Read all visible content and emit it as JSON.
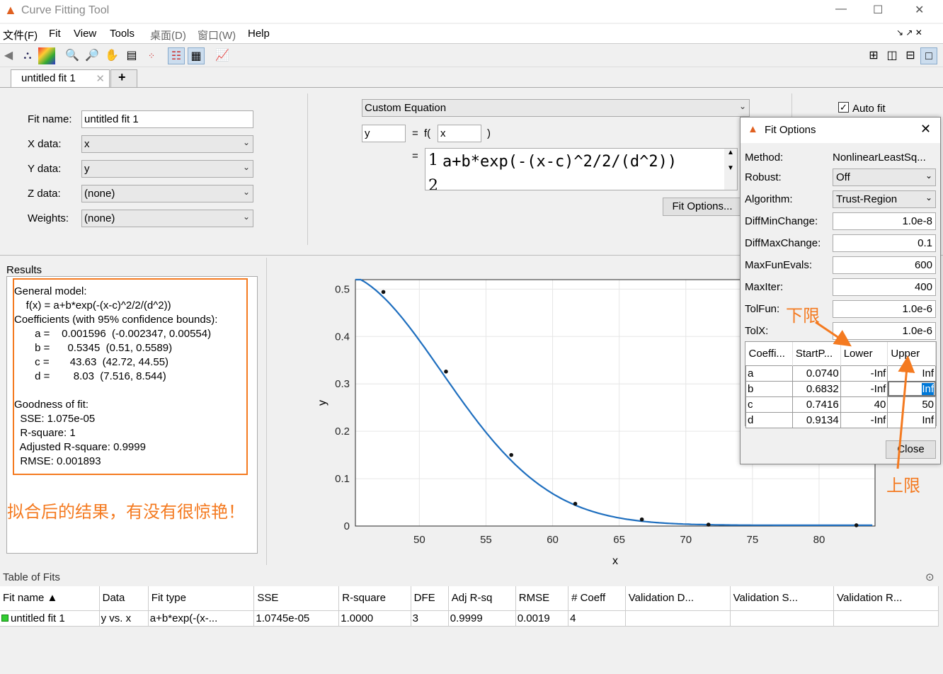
{
  "window": {
    "title": "Curve Fitting Tool"
  },
  "menu": [
    "文件(F)",
    "Fit",
    "View",
    "Tools",
    "桌面(D)",
    "窗口(W)",
    "Help"
  ],
  "tabs": [
    {
      "label": "untitled fit 1"
    }
  ],
  "fit_form": {
    "fit_name_label": "Fit name:",
    "fit_name": "untitled fit 1",
    "x_label": "X data:",
    "x": "x",
    "y_label": "Y data:",
    "y": "y",
    "z_label": "Z data:",
    "z": "(none)",
    "w_label": "Weights:",
    "w": "(none)"
  },
  "equation": {
    "type": "Custom Equation",
    "y": "y",
    "eq_sign": "=",
    "f_label": "f(",
    "var": "x",
    "close_paren": ")",
    "eq2": "=",
    "line_no": "1",
    "expr": "a+b*exp(-(x-c)^2/2/(d^2))",
    "line2": "2",
    "fit_options_btn": "Fit Options...",
    "auto_fit": "Auto fit",
    "auto_fit_checked": true
  },
  "results": {
    "title": "Results",
    "lines": [
      "General model:",
      "    f(x) = a+b*exp(-(x-c)^2/2/(d^2))",
      "Coefficients (with 95% confidence bounds):",
      "       a =    0.001596  (-0.002347, 0.00554)",
      "       b =      0.5345  (0.51, 0.5589)",
      "       c =       43.63  (42.72, 44.55)",
      "       d =        8.03  (7.516, 8.544)",
      "",
      "Goodness of fit:",
      "  SSE: 1.075e-05",
      "  R-square: 1",
      "  Adjusted R-square: 0.9999",
      "  RMSE: 0.001893"
    ],
    "annotation": "拟合后的结果，有没有很惊艳！"
  },
  "fit_options": {
    "title": "Fit Options",
    "close_label": "Close",
    "fields": [
      {
        "label": "Method:",
        "value": "NonlinearLeastSq..."
      },
      {
        "label": "Robust:",
        "value": "Off"
      },
      {
        "label": "Algorithm:",
        "value": "Trust-Region"
      },
      {
        "label": "DiffMinChange:",
        "value": "1.0e-8"
      },
      {
        "label": "DiffMaxChange:",
        "value": "0.1"
      },
      {
        "label": "MaxFunEvals:",
        "value": "600"
      },
      {
        "label": "MaxIter:",
        "value": "400"
      },
      {
        "label": "TolFun:",
        "value": "1.0e-6"
      },
      {
        "label": "TolX:",
        "value": "1.0e-6"
      }
    ],
    "columns": [
      "Coeffi...",
      "StartP...",
      "Lower",
      "Upper"
    ],
    "rows": [
      [
        "a",
        "0.0740",
        "-Inf",
        "Inf"
      ],
      [
        "b",
        "0.6832",
        "-Inf",
        "Inf"
      ],
      [
        "c",
        "0.7416",
        "40",
        "50"
      ],
      [
        "d",
        "0.9134",
        "-Inf",
        "Inf"
      ]
    ],
    "annotation_lower": "下限",
    "annotation_upper": "上限"
  },
  "chart_data": {
    "type": "scatter",
    "xlabel": "x",
    "ylabel": "y",
    "xlim": [
      45.2,
      84.2
    ],
    "ylim": [
      0,
      0.52
    ],
    "xticks": [
      50,
      55,
      60,
      65,
      70,
      75,
      80
    ],
    "yticks": [
      0,
      0.1,
      0.2,
      0.3,
      0.4,
      0.5
    ],
    "grid": true,
    "points": {
      "x": [
        47.3,
        52.0,
        56.9,
        61.7,
        66.7,
        71.7,
        82.8
      ],
      "y": [
        0.494,
        0.326,
        0.15,
        0.047,
        0.014,
        0.003,
        0.0016
      ]
    },
    "fit": {
      "a": 0.001596,
      "b": 0.5345,
      "c": 43.63,
      "d": 8.03
    },
    "line_color": "#1f6fbf"
  },
  "table_of_fits": {
    "title": "Table of Fits",
    "columns": [
      "Fit name ▲",
      "Data",
      "Fit type",
      "SSE",
      "R-square",
      "DFE",
      "Adj R-sq",
      "RMSE",
      "# Coeff",
      "Validation D...",
      "Validation S...",
      "Validation R..."
    ],
    "rows": [
      [
        "untitled fit 1",
        "y vs. x",
        "a+b*exp(-(x-...",
        "1.0745e-05",
        "1.0000",
        "3",
        "0.9999",
        "0.0019",
        "4",
        "",
        "",
        ""
      ]
    ]
  }
}
